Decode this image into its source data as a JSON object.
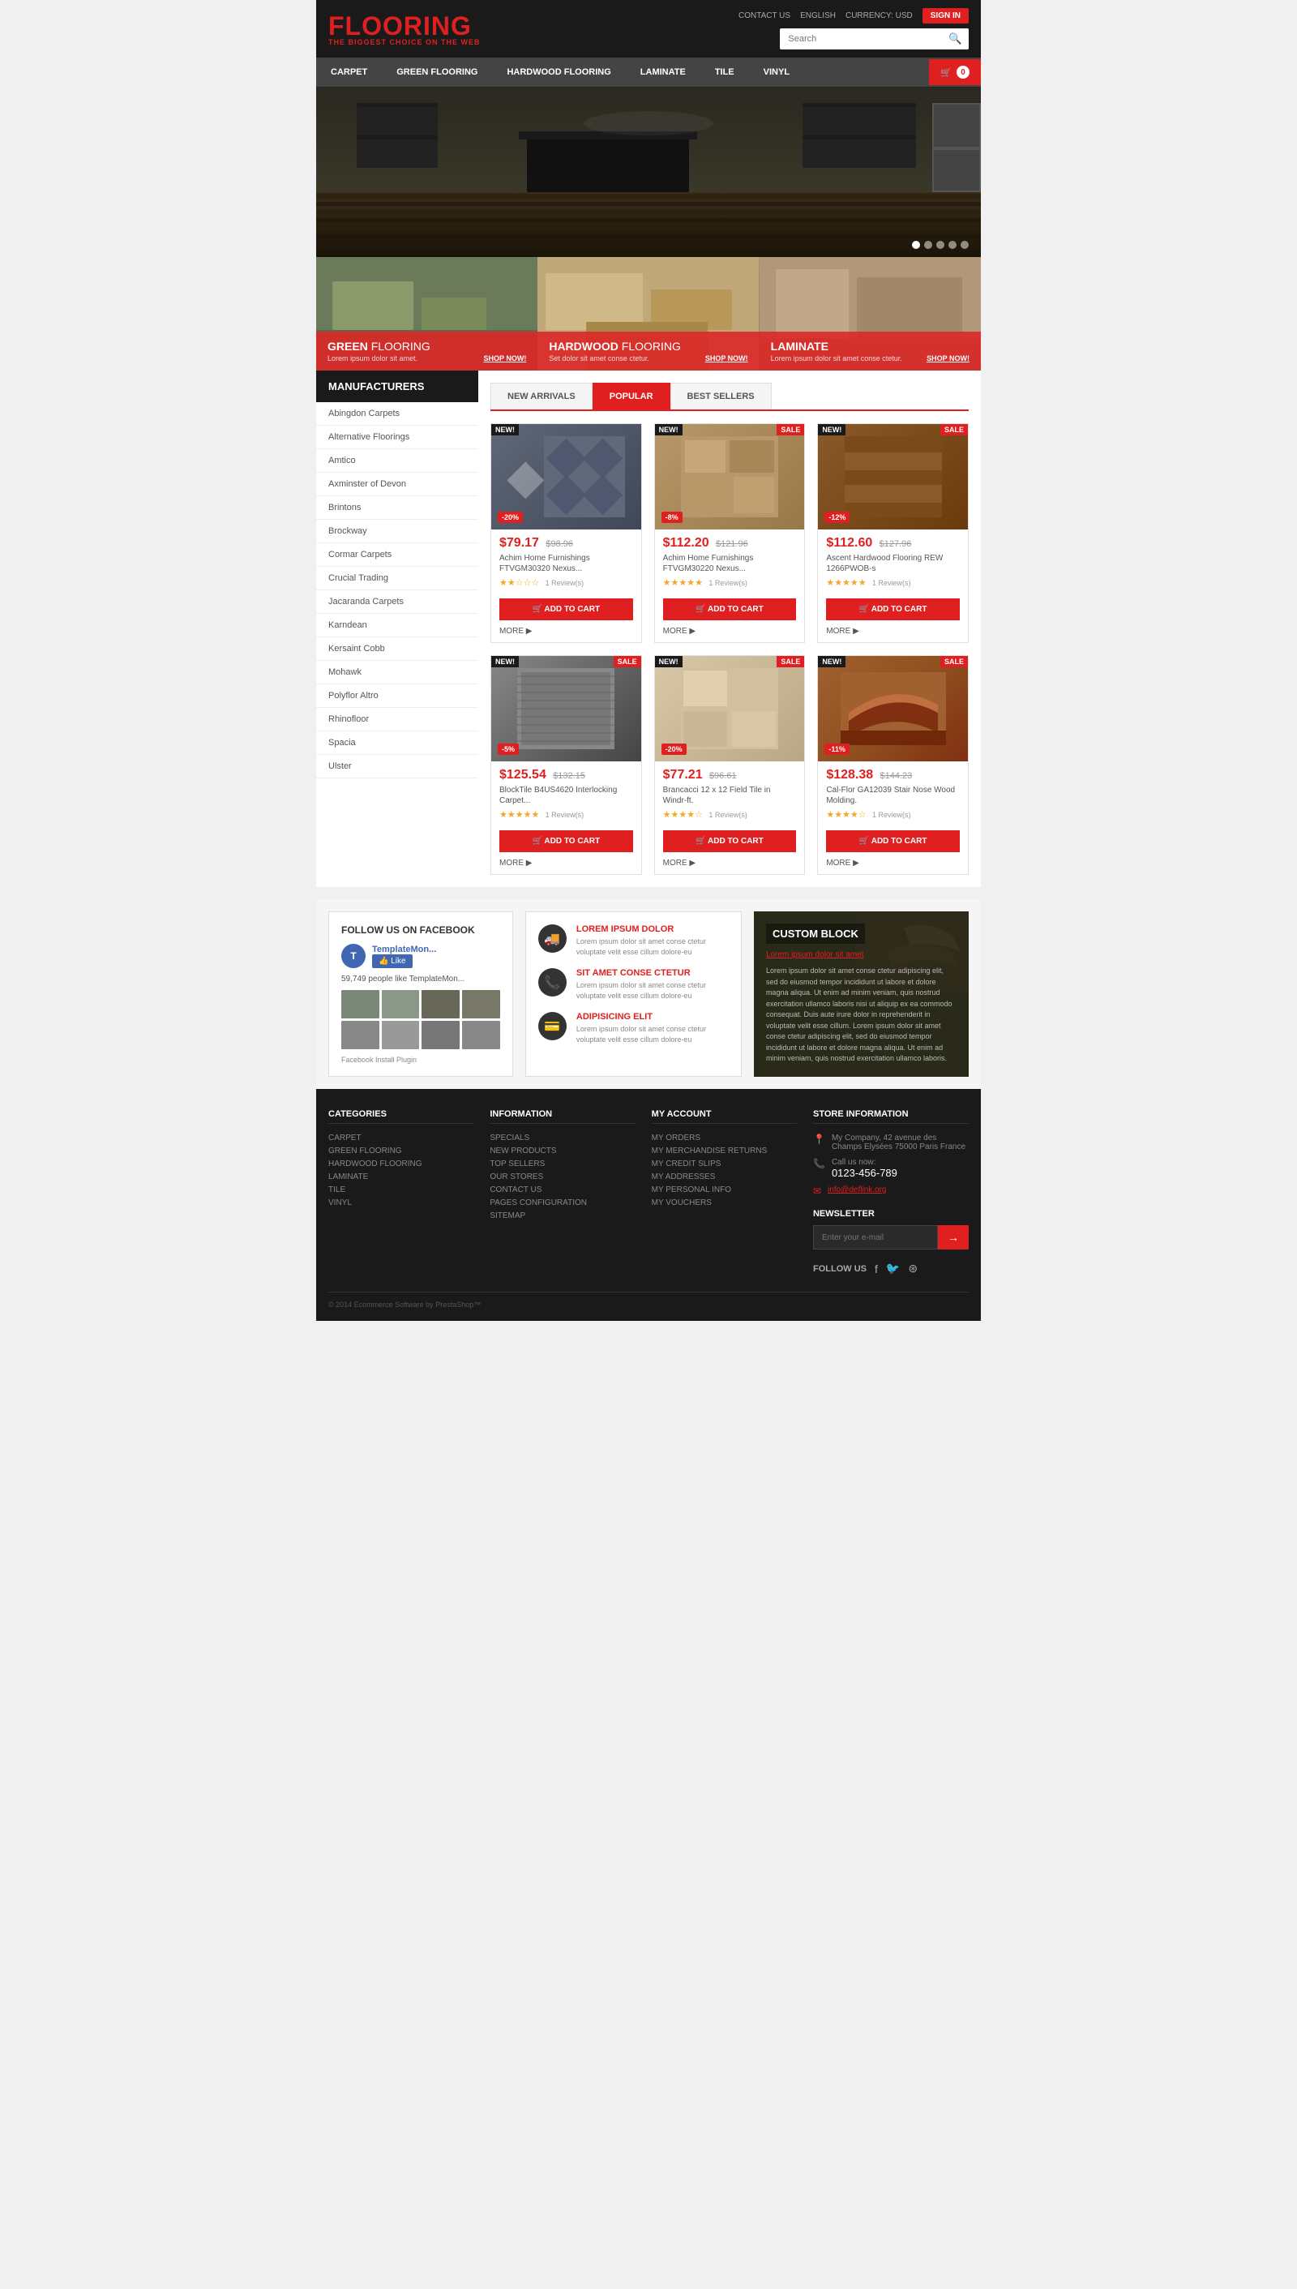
{
  "header": {
    "logo_main": "FLOO",
    "logo_accent": "RING",
    "logo_sub": "THE BIGGEST CHOICE ON THE WEB",
    "contact_us": "CONTACT US",
    "language": "ENGLISH",
    "currency": "CURRENCY: USD",
    "sign_in": "SIGN IN",
    "search_placeholder": "Search"
  },
  "nav": {
    "items": [
      {
        "label": "CARPET"
      },
      {
        "label": "GREEN FLOORING"
      },
      {
        "label": "HARDWOOD FLOORING"
      },
      {
        "label": "LAMINATE"
      },
      {
        "label": "TILE"
      },
      {
        "label": "VINYL"
      }
    ],
    "cart_count": "0"
  },
  "promo": {
    "cards": [
      {
        "title": "GREEN",
        "title_suffix": " FLOORING",
        "desc": "Lorem ipsum dolor sit amet.",
        "shop": "SHOP NOW!"
      },
      {
        "title": "HARDWOOD",
        "title_suffix": " FLOORING",
        "desc": "Set dolor sit amet conse ctetur.",
        "shop": "SHOP NOW!"
      },
      {
        "title": "LAMINATE",
        "title_suffix": "",
        "desc": "Lorem ipsum dolor sit amet conse ctetur.",
        "shop": "SHOP NOW!"
      }
    ]
  },
  "sidebar": {
    "title": "MANUFACTURERS",
    "items": [
      "Abingdon Carpets",
      "Alternative Floorings",
      "Amtico",
      "Axminster of Devon",
      "Brintons",
      "Brockway",
      "Cormar Carpets",
      "Crucial Trading",
      "Jacaranda Carpets",
      "Karndean",
      "Kersaint Cobb",
      "Mohawk",
      "Polyflor Altro",
      "Rhinofloor",
      "Spacia",
      "Ulster"
    ]
  },
  "products": {
    "tabs": [
      {
        "label": "NEW ARRIVALS"
      },
      {
        "label": "POPULAR"
      },
      {
        "label": "BEST SELLERS"
      }
    ],
    "active_tab": 1,
    "items": [
      {
        "id": 1,
        "badge_new": "NEW!",
        "badge_sale": "",
        "badge_discount": "-20%",
        "img_class": "tile1",
        "price": "$79.17",
        "old_price": "$98.96",
        "name": "Achim Home Furnishings FTVGM30320 Nexus...",
        "stars": 2,
        "reviews": "1 Review(s)",
        "add_to_cart": "ADD TO CART",
        "more": "MORE ▶"
      },
      {
        "id": 2,
        "badge_new": "NEW!",
        "badge_sale": "SALE",
        "badge_discount": "-8%",
        "img_class": "stone1",
        "price": "$112.20",
        "old_price": "$121.96",
        "name": "Achim Home Furnishings FTVGM30220 Nexus...",
        "stars": 5,
        "reviews": "1 Review(s)",
        "add_to_cart": "ADD TO CART",
        "more": "MORE ▶"
      },
      {
        "id": 3,
        "badge_new": "NEW!",
        "badge_sale": "SALE",
        "badge_discount": "-12%",
        "img_class": "wood1",
        "price": "$112.60",
        "old_price": "$127.96",
        "name": "Ascent Hardwood Flooring REW 1266PWOB-s",
        "stars": 5,
        "reviews": "1 Review(s)",
        "add_to_cart": "ADD TO CART",
        "more": "MORE ▶"
      },
      {
        "id": 4,
        "badge_new": "NEW!",
        "badge_sale": "SALE",
        "badge_discount": "-5%",
        "img_class": "carpet1",
        "price": "$125.54",
        "old_price": "$132.15",
        "name": "BlockTile B4US4620 Interlocking Carpet...",
        "stars": 5,
        "reviews": "1 Review(s)",
        "add_to_cart": "ADD TO CART",
        "more": "MORE ▶"
      },
      {
        "id": 5,
        "badge_new": "NEW!",
        "badge_sale": "SALE",
        "badge_discount": "-20%",
        "img_class": "tile2",
        "price": "$77.21",
        "old_price": "$96.61",
        "name": "Brancacci 12 x 12 Field Tile in Windr-ft.",
        "stars": 4,
        "reviews": "1 Review(s)",
        "add_to_cart": "ADD TO CART",
        "more": "MORE ▶"
      },
      {
        "id": 6,
        "badge_new": "NEW!",
        "badge_sale": "SALE",
        "badge_discount": "-11%",
        "img_class": "wood2",
        "price": "$128.38",
        "old_price": "$144.23",
        "name": "Cal-Flor GA12039 Stair Nose Wood Molding.",
        "stars": 4,
        "reviews": "1 Review(s)",
        "add_to_cart": "ADD TO CART",
        "more": "MORE ▶"
      }
    ]
  },
  "bottom": {
    "facebook": {
      "title": "FOLLOW US ON FACEBOOK",
      "brand_name": "TemplateMon...",
      "like_label": "Like",
      "followers": "59,749 people like TemplateMon...",
      "install_label": "Facebook Install Plugin"
    },
    "info": {
      "items": [
        {
          "icon": "🚚",
          "icon_style": "dark",
          "title": "LOREM IPSUM DOLOR",
          "text": "Lorem ipsum dolor sit amet conse ctetur voluptate velit esse cillum dolore-eu"
        },
        {
          "icon": "📞",
          "icon_style": "dark",
          "title": "SIT AMET CONSE CTETUR",
          "text": "Lorem ipsum dolor sit amet conse ctetur voluptate velit esse cillum dolore-eu"
        },
        {
          "icon": "💳",
          "icon_style": "dark",
          "title": "ADIPISICING ELIT",
          "text": "Lorem ipsum dolor sit amet conse ctetur voluptate velit esse cillum dolore-eu"
        }
      ]
    },
    "custom": {
      "title": "CUSTOM BLOCK",
      "link": "Lorem ipsum dolor sit amet",
      "text": "Lorem ipsum dolor sit amet conse ctetur adipiscing elit, sed do eiusmod tempor incididunt ut labore et dolore magna aliqua. Ut enim ad minim veniam, quis nostrud exercitation ullamco laboris nisi ut aliquip ex ea commodo consequat. Duis aute irure dolor in reprehenderit in voluptate velit esse cillum. Lorem ipsum dolor sit amet conse ctetur adipiscing elit, sed do eiusmod tempor incididunt ut labore et dolore magna aliqua. Ut enim ad minim veniam, quis nostrud exercitation ullamco laboris."
    }
  },
  "footer": {
    "cols": [
      {
        "title": "CATEGORIES",
        "links": [
          "CARPET",
          "GREEN FLOORING",
          "HARDWOOD FLOORING",
          "LAMINATE",
          "TILE",
          "VINYL"
        ]
      },
      {
        "title": "INFORMATION",
        "links": [
          "SPECIALS",
          "NEW PRODUCTS",
          "TOP SELLERS",
          "OUR STORES",
          "CONTACT US",
          "PAGES CONFIGURATION",
          "SITEMAP"
        ]
      },
      {
        "title": "MY ACCOUNT",
        "links": [
          "MY ORDERS",
          "MY MERCHANDISE RETURNS",
          "MY CREDIT SLIPS",
          "MY ADDRESSES",
          "MY PERSONAL INFO",
          "MY VOUCHERS"
        ]
      }
    ],
    "store": {
      "title": "STORE INFORMATION",
      "address": "My Company, 42 avenue des Champs Elysées 75000 Paris France",
      "phone_label": "Call us now:",
      "phone": "0123-456-789",
      "email": "info@deflink.org"
    },
    "newsletter": {
      "title": "NEWSLETTER",
      "placeholder": "Enter your e-mail",
      "btn": "→"
    },
    "follow_us": "FOLLOW US",
    "copyright": "© 2014 Ecommerce Software by PrestaShop™"
  }
}
